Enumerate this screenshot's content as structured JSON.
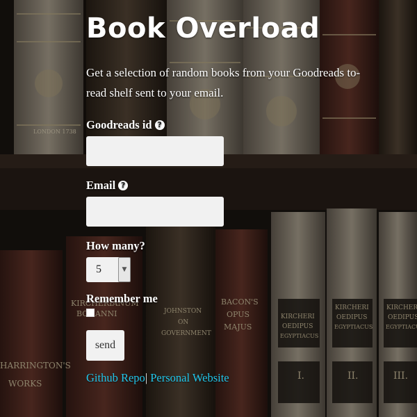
{
  "title": "Book Overload",
  "description": "Get a selection of random books from your Goodreads to-read shelf sent to your email.",
  "form": {
    "goodreads_label": "Goodreads id",
    "goodreads_value": "",
    "email_label": "Email",
    "email_value": "",
    "how_many_label": "How many?",
    "how_many_value": "5",
    "remember_label": "Remember me",
    "remember_checked": false,
    "send_label": "send"
  },
  "links": {
    "github": "Github Repo",
    "separator": "|",
    "website": "Personal Website"
  },
  "background": {
    "spine_texts": [
      "LONDON 1738",
      "KIRCHERIANUM",
      "BONANNI",
      "JOHNSTON",
      "ON",
      "GOVERNMENT",
      "BACON'S",
      "OPUS",
      "MAJUS",
      "KIRCHERI",
      "OEDIPUS",
      "EGYPTIACUS",
      "KIRCHERI",
      "OEDIPUS",
      "EGYPTIACUS",
      "KIRCHERI",
      "OEDIPUS",
      "EGYPTIACUS",
      "HARRINGTON'S",
      "WORKS",
      "I.",
      "II.",
      "III."
    ]
  },
  "colors": {
    "link": "#22c6ea",
    "text": "#ffffff",
    "input_bg": "#f1f1f1"
  }
}
